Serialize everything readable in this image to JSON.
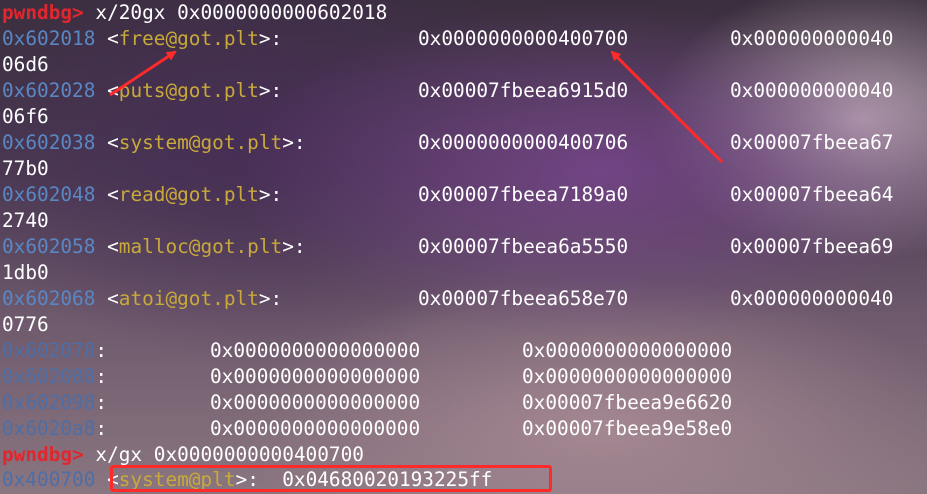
{
  "prompt1": {
    "label": "pwndbg>",
    "command": " x/20gx 0x0000000000602018"
  },
  "got_rows": [
    {
      "addr": "0x602018",
      "sym": "free@got.plt",
      "val1": "0x0000000000400700",
      "val2_part1": "0x000000000040",
      "val2_part2": "06d6"
    },
    {
      "addr": "0x602028",
      "sym": "puts@got.plt",
      "val1": "0x00007fbeea6915d0",
      "val2_part1": "0x000000000040",
      "val2_part2": "06f6"
    },
    {
      "addr": "0x602038",
      "sym": "system@got.plt",
      "val1": "0x0000000000400706",
      "val2_part1": "0x00007fbeea67",
      "val2_part2": "77b0"
    },
    {
      "addr": "0x602048",
      "sym": "read@got.plt",
      "val1": "0x00007fbeea7189a0",
      "val2_part1": "0x00007fbeea64",
      "val2_part2": "2740"
    },
    {
      "addr": "0x602058",
      "sym": "malloc@got.plt",
      "val1": "0x00007fbeea6a5550",
      "val2_part1": "0x00007fbeea69",
      "val2_part2": "1db0"
    },
    {
      "addr": "0x602068",
      "sym": "atoi@got.plt",
      "val1": "0x00007fbeea658e70",
      "val2_part1": "0x000000000040",
      "val2_part2": "0776"
    }
  ],
  "plain_rows": [
    {
      "addr": "0x602078",
      "val1": "0x0000000000000000",
      "val2": "0x0000000000000000"
    },
    {
      "addr": "0x602088",
      "val1": "0x0000000000000000",
      "val2": "0x0000000000000000"
    },
    {
      "addr": "0x602098",
      "val1": "0x0000000000000000",
      "val2": "0x00007fbeea9e6620"
    },
    {
      "addr": "0x6020a8",
      "val1": "0x0000000000000000",
      "val2": "0x00007fbeea9e58e0"
    }
  ],
  "prompt2": {
    "label": "pwndbg>",
    "command": " x/gx 0x0000000000400700"
  },
  "result": {
    "addr": "0x400700",
    "sym": "system@plt",
    "val": "0x04680020193225ff"
  },
  "colors": {
    "address": "#5a87c4",
    "symbol": "#c8a93a",
    "prompt": "#e0262e",
    "annotation": "#ff2a2a"
  }
}
